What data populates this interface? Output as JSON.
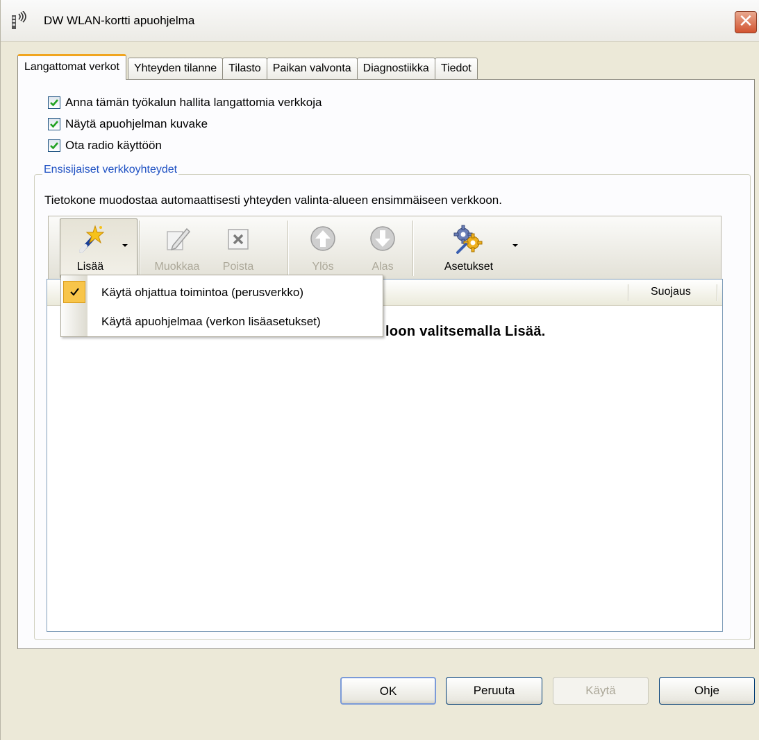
{
  "window": {
    "title": "DW WLAN-kortti apuohjelma",
    "close_glyph": "✕"
  },
  "tabs": [
    {
      "label": "Langattomat verkot",
      "active": true
    },
    {
      "label": "Yhteyden tilanne",
      "active": false
    },
    {
      "label": "Tilasto",
      "active": false
    },
    {
      "label": "Paikan valvonta",
      "active": false
    },
    {
      "label": "Diagnostiikka",
      "active": false
    },
    {
      "label": "Tiedot",
      "active": false
    }
  ],
  "options": [
    {
      "label": "Anna tämän työkalun hallita langattomia verkkoja",
      "checked": true
    },
    {
      "label": "Näytä apuohjelman kuvake",
      "checked": true
    },
    {
      "label": "Ota radio käyttöön",
      "checked": true
    }
  ],
  "preferred": {
    "legend": "Ensisijaiset verkkoyhteydet",
    "description": "Tietokone muodostaa automaattisesti yhteyden valinta-alueen ensimmäiseen verkkoon."
  },
  "toolbar": {
    "add": {
      "label": "Lisää",
      "icon": "magic-wand-icon",
      "enabled": true
    },
    "edit": {
      "label": "Muokkaa",
      "icon": "pencil-icon",
      "enabled": false
    },
    "remove": {
      "label": "Poista",
      "icon": "delete-icon",
      "enabled": false
    },
    "up": {
      "label": "Ylös",
      "icon": "arrow-up-icon",
      "enabled": false
    },
    "down": {
      "label": "Alas",
      "icon": "arrow-down-icon",
      "enabled": false
    },
    "settings": {
      "label": "Asetukset",
      "icon": "gears-icon",
      "enabled": true
    }
  },
  "list": {
    "columns": [
      "Suojaus"
    ],
    "empty_message": "loon valitsemalla Lisää."
  },
  "add_menu": {
    "items": [
      {
        "label": "Käytä ohjattua toimintoa (perusverkko)",
        "checked": true
      },
      {
        "label": "Käytä apuohjelmaa (verkon lisäasetukset)",
        "checked": false
      }
    ]
  },
  "buttons": {
    "ok": "OK",
    "cancel": "Peruuta",
    "apply": "Käytä",
    "help": "Ohje"
  },
  "colors": {
    "dialog_bg": "#ece9d8",
    "active_tab_accent": "#f0a520",
    "group_legend": "#1f51c3",
    "menu_check_bg": "#f8c54a",
    "disabled_text": "#aca899"
  }
}
